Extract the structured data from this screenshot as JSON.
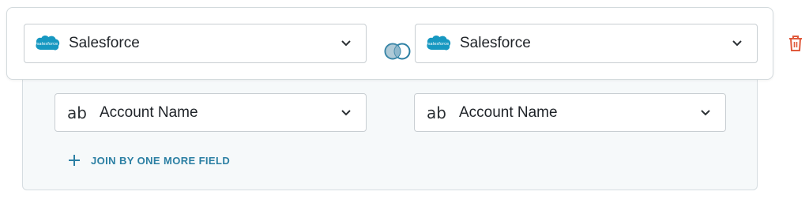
{
  "source_left": {
    "name": "Salesforce",
    "icon": "salesforce-logo-icon",
    "logo_text": "salesforce"
  },
  "source_right": {
    "name": "Salesforce",
    "icon": "salesforce-logo-icon",
    "logo_text": "salesforce"
  },
  "join_icon": "venn-join-icon",
  "delete_icon": "trash-icon",
  "field_left": {
    "type_icon": "ab",
    "name": "Account Name"
  },
  "field_right": {
    "type_icon": "ab",
    "name": "Account Name"
  },
  "add_field_label": "JOIN BY ONE MORE FIELD",
  "colors": {
    "salesforce_blue": "#1798c1",
    "accent_teal": "#2b7fa3",
    "delete_red": "#e05a3c",
    "panel_bg": "#f6f9fa"
  }
}
